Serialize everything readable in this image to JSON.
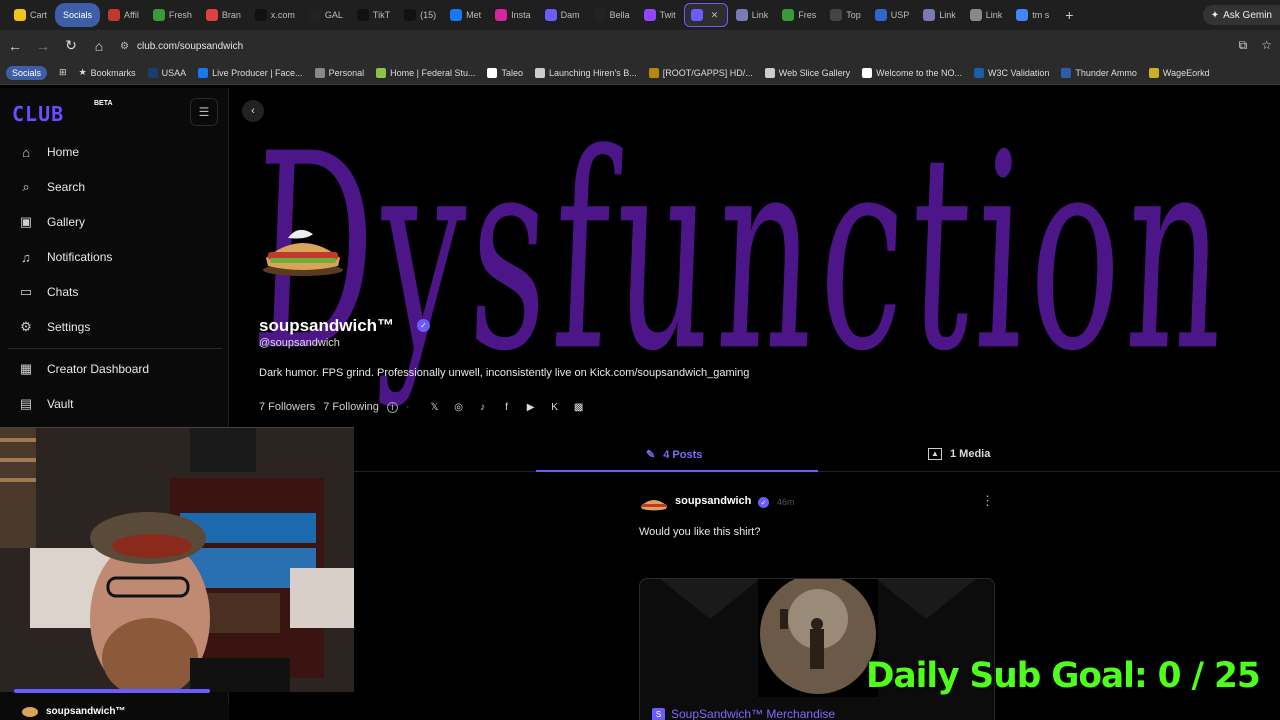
{
  "browser": {
    "tabs": [
      {
        "label": "Cart",
        "color": "#f0c419"
      },
      {
        "label": "Socials",
        "group": true
      },
      {
        "label": "Affil",
        "color": "#c0392b"
      },
      {
        "label": "Fresh",
        "color": "#3a9a3a"
      },
      {
        "label": "Bran",
        "color": "#e04040"
      },
      {
        "label": "x.com",
        "color": "#111111"
      },
      {
        "label": "GAL",
        "color": "#222222"
      },
      {
        "label": "TikT",
        "color": "#111111"
      },
      {
        "label": "(15)",
        "color": "#111111"
      },
      {
        "label": "Met",
        "color": "#1877f2"
      },
      {
        "label": "Insta",
        "color": "#d6249f"
      },
      {
        "label": "Dam",
        "color": "#6a5cff"
      },
      {
        "label": "Bella",
        "color": "#222222"
      },
      {
        "label": "Twit",
        "color": "#9146ff"
      },
      {
        "label": "",
        "color": "#6a5cff",
        "active": true
      },
      {
        "label": "Link",
        "color": "#7a7ab5"
      },
      {
        "label": "Fres",
        "color": "#3a9a3a"
      },
      {
        "label": "Top",
        "color": "#444444"
      },
      {
        "label": "USP",
        "color": "#3366cc"
      },
      {
        "label": "Link",
        "color": "#7a7ab5"
      },
      {
        "label": "Link",
        "color": "#888888"
      },
      {
        "label": "tm s",
        "color": "#4285f4"
      }
    ],
    "ask_gemini": "Ask Gemin",
    "url": "club.com/soupsandwich",
    "bookmarks": [
      {
        "label": "Socials",
        "group": true
      },
      {
        "label": "Bookmarks",
        "icon": "star-icon"
      },
      {
        "label": "USAA",
        "color": "#1a3d6e"
      },
      {
        "label": "Live Producer | Face...",
        "color": "#1877f2"
      },
      {
        "label": "Personal",
        "color": "#888888"
      },
      {
        "label": "Home | Federal Stu...",
        "color": "#8bc34a"
      },
      {
        "label": "Taleo",
        "color": "#ffffff"
      },
      {
        "label": "Launching Hiren's B...",
        "color": "#cccccc"
      },
      {
        "label": "[ROOT/GAPPS] HD/...",
        "color": "#b8860b"
      },
      {
        "label": "Web Slice Gallery",
        "color": "#cccccc"
      },
      {
        "label": "Welcome to the NO...",
        "color": "#ffffff"
      },
      {
        "label": "W3C Validation",
        "color": "#1a5ea8"
      },
      {
        "label": "Thunder Ammo",
        "color": "#2a5ea8"
      },
      {
        "label": "WageEorkd",
        "color": "#c9b020"
      }
    ]
  },
  "sidebar": {
    "logo": "CLUB",
    "beta": "BETA",
    "items": [
      {
        "label": "Home",
        "icon": "home-icon"
      },
      {
        "label": "Search",
        "icon": "search-icon"
      },
      {
        "label": "Gallery",
        "icon": "gallery-icon"
      },
      {
        "label": "Notifications",
        "icon": "bell-icon"
      },
      {
        "label": "Chats",
        "icon": "chat-icon"
      },
      {
        "label": "Settings",
        "icon": "gear-icon"
      },
      {
        "label": "Creator Dashboard",
        "icon": "dashboard-icon"
      },
      {
        "label": "Vault",
        "icon": "vault-icon"
      }
    ]
  },
  "profile": {
    "banner_text": "Dysfunction is a family reck",
    "display_name": "soupsandwich™",
    "handle": "@soupsandwich",
    "bio": "Dark humor. FPS grind. Professionally unwell, inconsistently live on Kick.com/soupsandwich_gaming",
    "followers": "7 Followers",
    "following": "7 Following",
    "socials": [
      "x-icon",
      "instagram-icon",
      "tiktok-icon",
      "facebook-icon",
      "youtube-icon",
      "kick-icon",
      "twitch-icon"
    ]
  },
  "tabs": {
    "posts": "4 Posts",
    "media": "1 Media"
  },
  "post": {
    "author": "soupsandwich",
    "time": "46m",
    "text": "Would you like this shirt?",
    "link": "SoupSandwich™ Merchandise"
  },
  "overlay": {
    "sub_goal": "Daily Sub Goal:  0 / 25",
    "cam_footer_name": "soupsandwich™"
  },
  "colors": {
    "accent": "#6a5cff",
    "banner_purple": "#5a1aa0",
    "sub_goal_green": "#4dff1a"
  }
}
